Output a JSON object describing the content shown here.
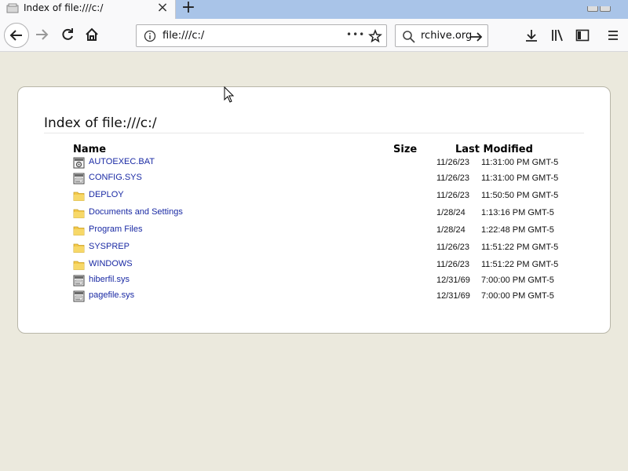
{
  "tab": {
    "title": "Index of file:///c:/",
    "close_label": "×",
    "newtab_label": "+"
  },
  "nav": {
    "url": "file:///c:/",
    "search_value": "rchive.org",
    "menu_dots": "•••"
  },
  "page": {
    "heading": "Index of file:///c:/",
    "columns": {
      "name": "Name",
      "size": "Size",
      "modified": "Last Modified"
    },
    "rows": [
      {
        "name": "AUTOEXEC.BAT",
        "icon": "batch-file-icon",
        "date": "11/26/23",
        "time": "11:31:00 PM GMT-5"
      },
      {
        "name": "CONFIG.SYS",
        "icon": "system-file-icon",
        "date": "11/26/23",
        "time": "11:31:00 PM GMT-5"
      },
      {
        "name": "DEPLOY",
        "icon": "folder-icon",
        "date": "11/26/23",
        "time": "11:50:50 PM GMT-5"
      },
      {
        "name": "Documents and Settings",
        "icon": "folder-icon",
        "date": "1/28/24",
        "time": "1:13:16 PM GMT-5"
      },
      {
        "name": "Program Files",
        "icon": "folder-icon",
        "date": "1/28/24",
        "time": "1:22:48 PM GMT-5"
      },
      {
        "name": "SYSPREP",
        "icon": "folder-icon",
        "date": "11/26/23",
        "time": "11:51:22 PM GMT-5"
      },
      {
        "name": "WINDOWS",
        "icon": "folder-icon",
        "date": "11/26/23",
        "time": "11:51:22 PM GMT-5"
      },
      {
        "name": "hiberfil.sys",
        "icon": "system-file-icon",
        "date": "12/31/69",
        "time": "7:00:00 PM GMT-5"
      },
      {
        "name": "pagefile.sys",
        "icon": "system-file-icon",
        "date": "12/31/69",
        "time": "7:00:00 PM GMT-5"
      }
    ]
  },
  "colors": {
    "link": "#1a2aa4",
    "page_bg": "#ebe9dd",
    "tabstrip": "#a9c4e8",
    "folder": "#f3c84a"
  }
}
